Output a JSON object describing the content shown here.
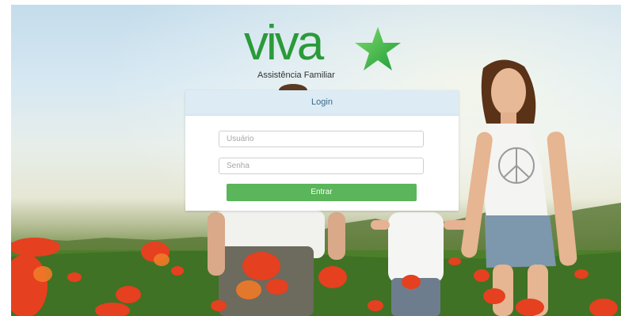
{
  "brand": {
    "name": "viva",
    "tagline": "Assistência Familiar",
    "color": "#2b9a3a",
    "star_icon": "green-star-icon"
  },
  "login": {
    "title": "Login",
    "username_placeholder": "Usuário",
    "password_placeholder": "Senha",
    "submit_label": "Entrar",
    "submit_color": "#5bb55a",
    "header_color": "#dcebf4"
  }
}
